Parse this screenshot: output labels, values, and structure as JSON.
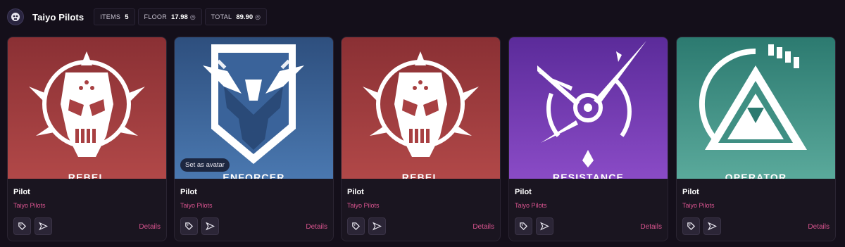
{
  "header": {
    "title": "Taiyo Pilots",
    "stats": [
      {
        "label": "ITEMS",
        "value": "5"
      },
      {
        "label": "FLOOR",
        "value": "17.98",
        "unit": "◎"
      },
      {
        "label": "TOTAL",
        "value": "89.90",
        "unit": "◎"
      }
    ]
  },
  "cards": [
    {
      "art_label": "REBEL",
      "name": "Pilot",
      "collection": "Taiyo Pilots",
      "details": "Details",
      "color_top": "#8a3034",
      "color_bottom": "#b14848",
      "emblem": "skull"
    },
    {
      "art_label": "ENFORCER",
      "name": "Pilot",
      "collection": "Taiyo Pilots",
      "details": "Details",
      "color_top": "#2e4f7e",
      "color_bottom": "#4a78b0",
      "emblem": "eagle",
      "avatar_button": "Set as avatar"
    },
    {
      "art_label": "REBEL",
      "name": "Pilot",
      "collection": "Taiyo Pilots",
      "details": "Details",
      "color_top": "#8a3034",
      "color_bottom": "#b14848",
      "emblem": "skull"
    },
    {
      "art_label": "RESISTANCE",
      "name": "Pilot",
      "collection": "Taiyo Pilots",
      "details": "Details",
      "color_top": "#5b2b9a",
      "color_bottom": "#8a4bc6",
      "emblem": "compass"
    },
    {
      "art_label": "OPERATOR",
      "name": "Pilot",
      "collection": "Taiyo Pilots",
      "details": "Details",
      "color_top": "#2c7a70",
      "color_bottom": "#5aa99b",
      "emblem": "triangle"
    }
  ],
  "icons": {
    "tag": "tag-icon",
    "send": "send-icon"
  },
  "colors": {
    "accent": "#d9548f",
    "background": "#140f1a"
  }
}
